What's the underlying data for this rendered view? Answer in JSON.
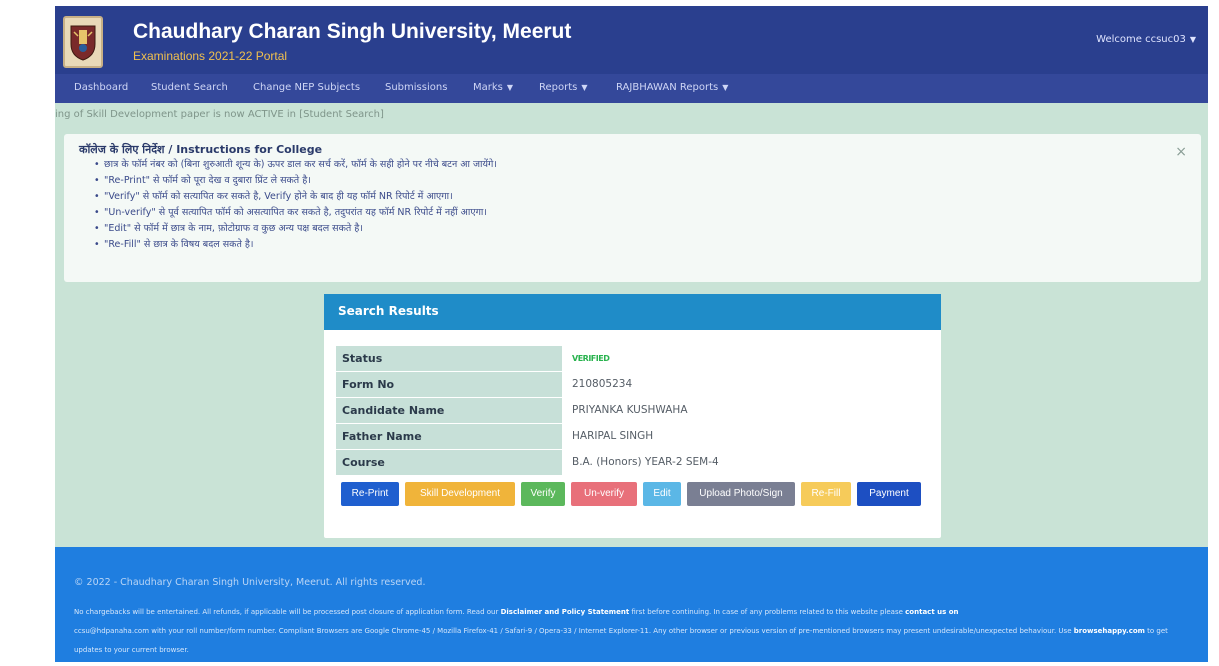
{
  "header": {
    "title": "Chaudhary Charan Singh University, Meerut",
    "subtitle": "Examinations 2021-22 Portal",
    "welcome": "Welcome ccsuc03"
  },
  "nav": {
    "items": [
      {
        "label": "Dashboard"
      },
      {
        "label": "Student Search"
      },
      {
        "label": "Change NEP Subjects"
      },
      {
        "label": "Submissions"
      },
      {
        "label": "Marks"
      },
      {
        "label": "Reports"
      },
      {
        "label": "RAJBHAWAN Reports"
      }
    ]
  },
  "ticker": "ing of Skill Development paper is now ACTIVE in [Student Search]",
  "instructions": {
    "title": "कॉलेज के लिए निर्देश / Instructions for College",
    "items": [
      "छात्र के फॉर्म नंबर को (बिना शुरुआती शून्य के) ऊपर डाल कर सर्च करें, फॉर्म के सही होने पर नीचे बटन आ जायेंगे।",
      "\"Re-Print\" से फॉर्म को पूरा देख व दुबारा प्रिंट ले सकते है।",
      "\"Verify\" से फॉर्म को सत्यापित कर सकते है, Verify होने के बाद ही यह फॉर्म NR रिपोर्ट में आएगा।",
      "\"Un-verify\" से पूर्व सत्यापित फॉर्म को असत्यापित कर सकते है, तदुपरांत यह फॉर्म NR रिपोर्ट में नहीं आएगा।",
      "\"Edit\" से फॉर्म में छात्र के नाम, फ़ोटोग्राफ व कुछ अन्य पक्ष बदल सकते है।",
      "\"Re-Fill\" से छात्र के विषय बदल सकते है।"
    ],
    "close": "×"
  },
  "results": {
    "title": "Search Results",
    "rows": [
      {
        "label": "Status",
        "value": "VERIFIED"
      },
      {
        "label": "Form No",
        "value": "210805234"
      },
      {
        "label": "Candidate Name",
        "value": "PRIYANKA KUSHWAHA"
      },
      {
        "label": "Father Name",
        "value": "HARIPAL SINGH"
      },
      {
        "label": "Course",
        "value": "B.A. (Honors) YEAR-2 SEM-4"
      }
    ],
    "buttons": [
      {
        "label": "Re-Print",
        "color": "#1f5fcf"
      },
      {
        "label": "Skill Development",
        "color": "#f0b43a"
      },
      {
        "label": "Verify",
        "color": "#5cb85c"
      },
      {
        "label": "Un-verify",
        "color": "#e8707a"
      },
      {
        "label": "Edit",
        "color": "#5bb7e6"
      },
      {
        "label": "Upload Photo/Sign",
        "color": "#7a7f93"
      },
      {
        "label": "Re-Fill",
        "color": "#f6cb5a"
      },
      {
        "label": "Payment",
        "color": "#1d4fc2"
      }
    ]
  },
  "footer": {
    "copyright": "© 2022 - Chaudhary Charan Singh University, Meerut. All rights reserved.",
    "text_a": "No chargebacks will be entertained. All refunds, if applicable will be processed post closure of application form. Read our ",
    "disclaimer": "Disclaimer and Policy Statement",
    "text_b": " first before continuing. In case of any problems related to this website please ",
    "contact": "contact us on",
    "text_c": "ccsu@hdpanaha.com with your roll number/form number. Compliant Browsers are Google Chrome-45 / Mozilla Firefox-41 / Safari-9 / Opera-33 / Internet Explorer-11. Any other browser or previous version of pre-mentioned browsers may present undesirable/unexpected behaviour. Use ",
    "browsehappy": "browsehappy.com",
    "text_d": " to get updates to your current browser."
  },
  "colors": {
    "header_bg": "#2a3f8e",
    "nav_bg": "#34489a",
    "page_bg": "#c9e3d6",
    "results_header": "#1f8cc8",
    "footer_bg": "#1f7ee0",
    "subtitle": "#f1c04e"
  }
}
